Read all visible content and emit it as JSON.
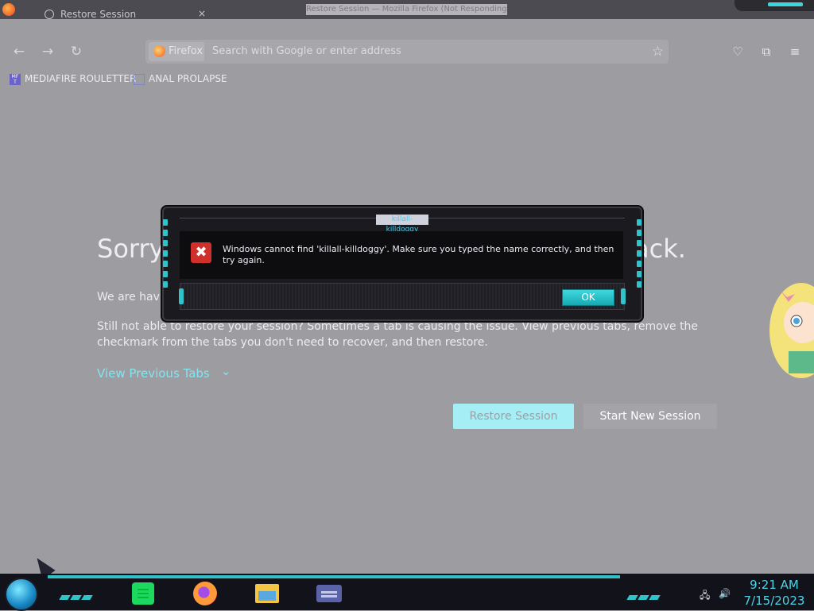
{
  "window": {
    "title": "Restore Session — Mozilla Firefox (Not Responding)",
    "tab_label": "Restore Session",
    "tab_close": "×"
  },
  "navbar": {
    "identity_label": "Firefox",
    "url_placeholder": "Search with Google or enter address"
  },
  "bookmarks": [
    {
      "label": "MEDIAFIRE ROULETTER"
    },
    {
      "label": "ANAL PROLAPSE"
    }
  ],
  "page": {
    "heading": "Sorry.",
    "heading_tail": "ack.",
    "para1": "We are havi",
    "para2": "Still not able to restore your session? Sometimes a tab is causing the issue. View previous tabs, remove the checkmark from the tabs you don't need to recover, and then restore.",
    "view_previous": "View Previous Tabs",
    "restore_button": "Restore Session",
    "new_session_button": "Start New Session"
  },
  "dialog": {
    "title": "killall-killdoggy",
    "message": "Windows cannot find 'killall-killdoggy'. Make sure you typed the name correctly, and then try again.",
    "ok_label": "OK"
  },
  "taskbar": {
    "time": "9:21 AM",
    "date": "7/15/2023",
    "apps": [
      "spotify-icon",
      "firefox-icon",
      "file-explorer-icon",
      "remote-desktop-icon"
    ]
  },
  "colors": {
    "accent": "#2fc3cc",
    "link": "#84e4ef",
    "error": "#d0302b"
  }
}
